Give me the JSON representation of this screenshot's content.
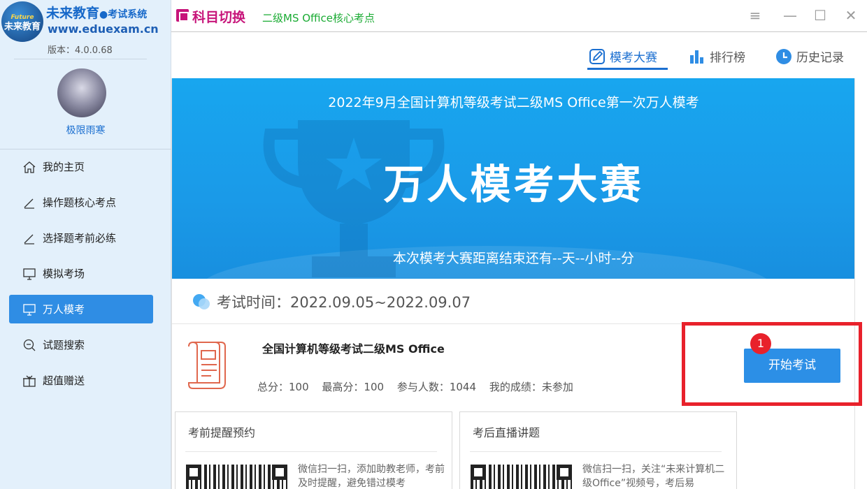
{
  "app": {
    "brand": "未来教育",
    "brand_sub": "●考试系统",
    "site": "www.eduexam.cn",
    "version": "版本：4.0.0.68",
    "logo_text": "未来教育",
    "logo_small": "Future"
  },
  "user": {
    "name": "极限雨寒"
  },
  "sidebar": {
    "items": [
      {
        "label": "我的主页",
        "icon": "home-icon"
      },
      {
        "label": "操作题核心考点",
        "icon": "pen-icon"
      },
      {
        "label": "选择题考前必练",
        "icon": "pen-icon"
      },
      {
        "label": "模拟考场",
        "icon": "monitor-icon"
      },
      {
        "label": "万人模考",
        "icon": "monitor-icon",
        "active": true
      },
      {
        "label": "试题搜索",
        "icon": "search-icon"
      },
      {
        "label": "超值赠送",
        "icon": "gift-icon"
      }
    ]
  },
  "titlebar": {
    "switch_label": "科目切换",
    "subject": "二级MS Office核心考点",
    "controls": [
      "≡",
      "—",
      "☐",
      "✕"
    ]
  },
  "tabs": {
    "items": [
      {
        "label": "模考大赛",
        "icon": "edit-icon",
        "active": true
      },
      {
        "label": "排行榜",
        "icon": "bar-chart-icon"
      },
      {
        "label": "历史记录",
        "icon": "clock-icon"
      }
    ]
  },
  "banner": {
    "title": "2022年9月全国计算机等级考试二级MS Office第一次万人模考",
    "main": "万人模考大赛",
    "countdown": "本次模考大赛距离结束还有--天--小时--分"
  },
  "exam": {
    "time": "考试时间：2022.09.05~2022.09.07",
    "name": "全国计算机等级考试二级MS Office",
    "total": "总分：100",
    "max": "最高分：100",
    "participants": "参与人数：1044",
    "my_score": "我的成绩：未参加",
    "start_button": "开始考试",
    "badge": "1"
  },
  "cards": [
    {
      "title": "考前提醒预约",
      "text": "微信扫一扫，添加助教老师，考前及时提醒，避免错过模考"
    },
    {
      "title": "考后直播讲题",
      "text": "微信扫一扫，关注“未来计算机二级Office”视频号，考后易"
    }
  ],
  "colors": {
    "accent": "#1b6fd0",
    "active_nav": "#2f8de4",
    "banner": "#18a6ef",
    "switch": "#c7157a",
    "subject": "#1aab33",
    "highlight": "#e8212b"
  }
}
